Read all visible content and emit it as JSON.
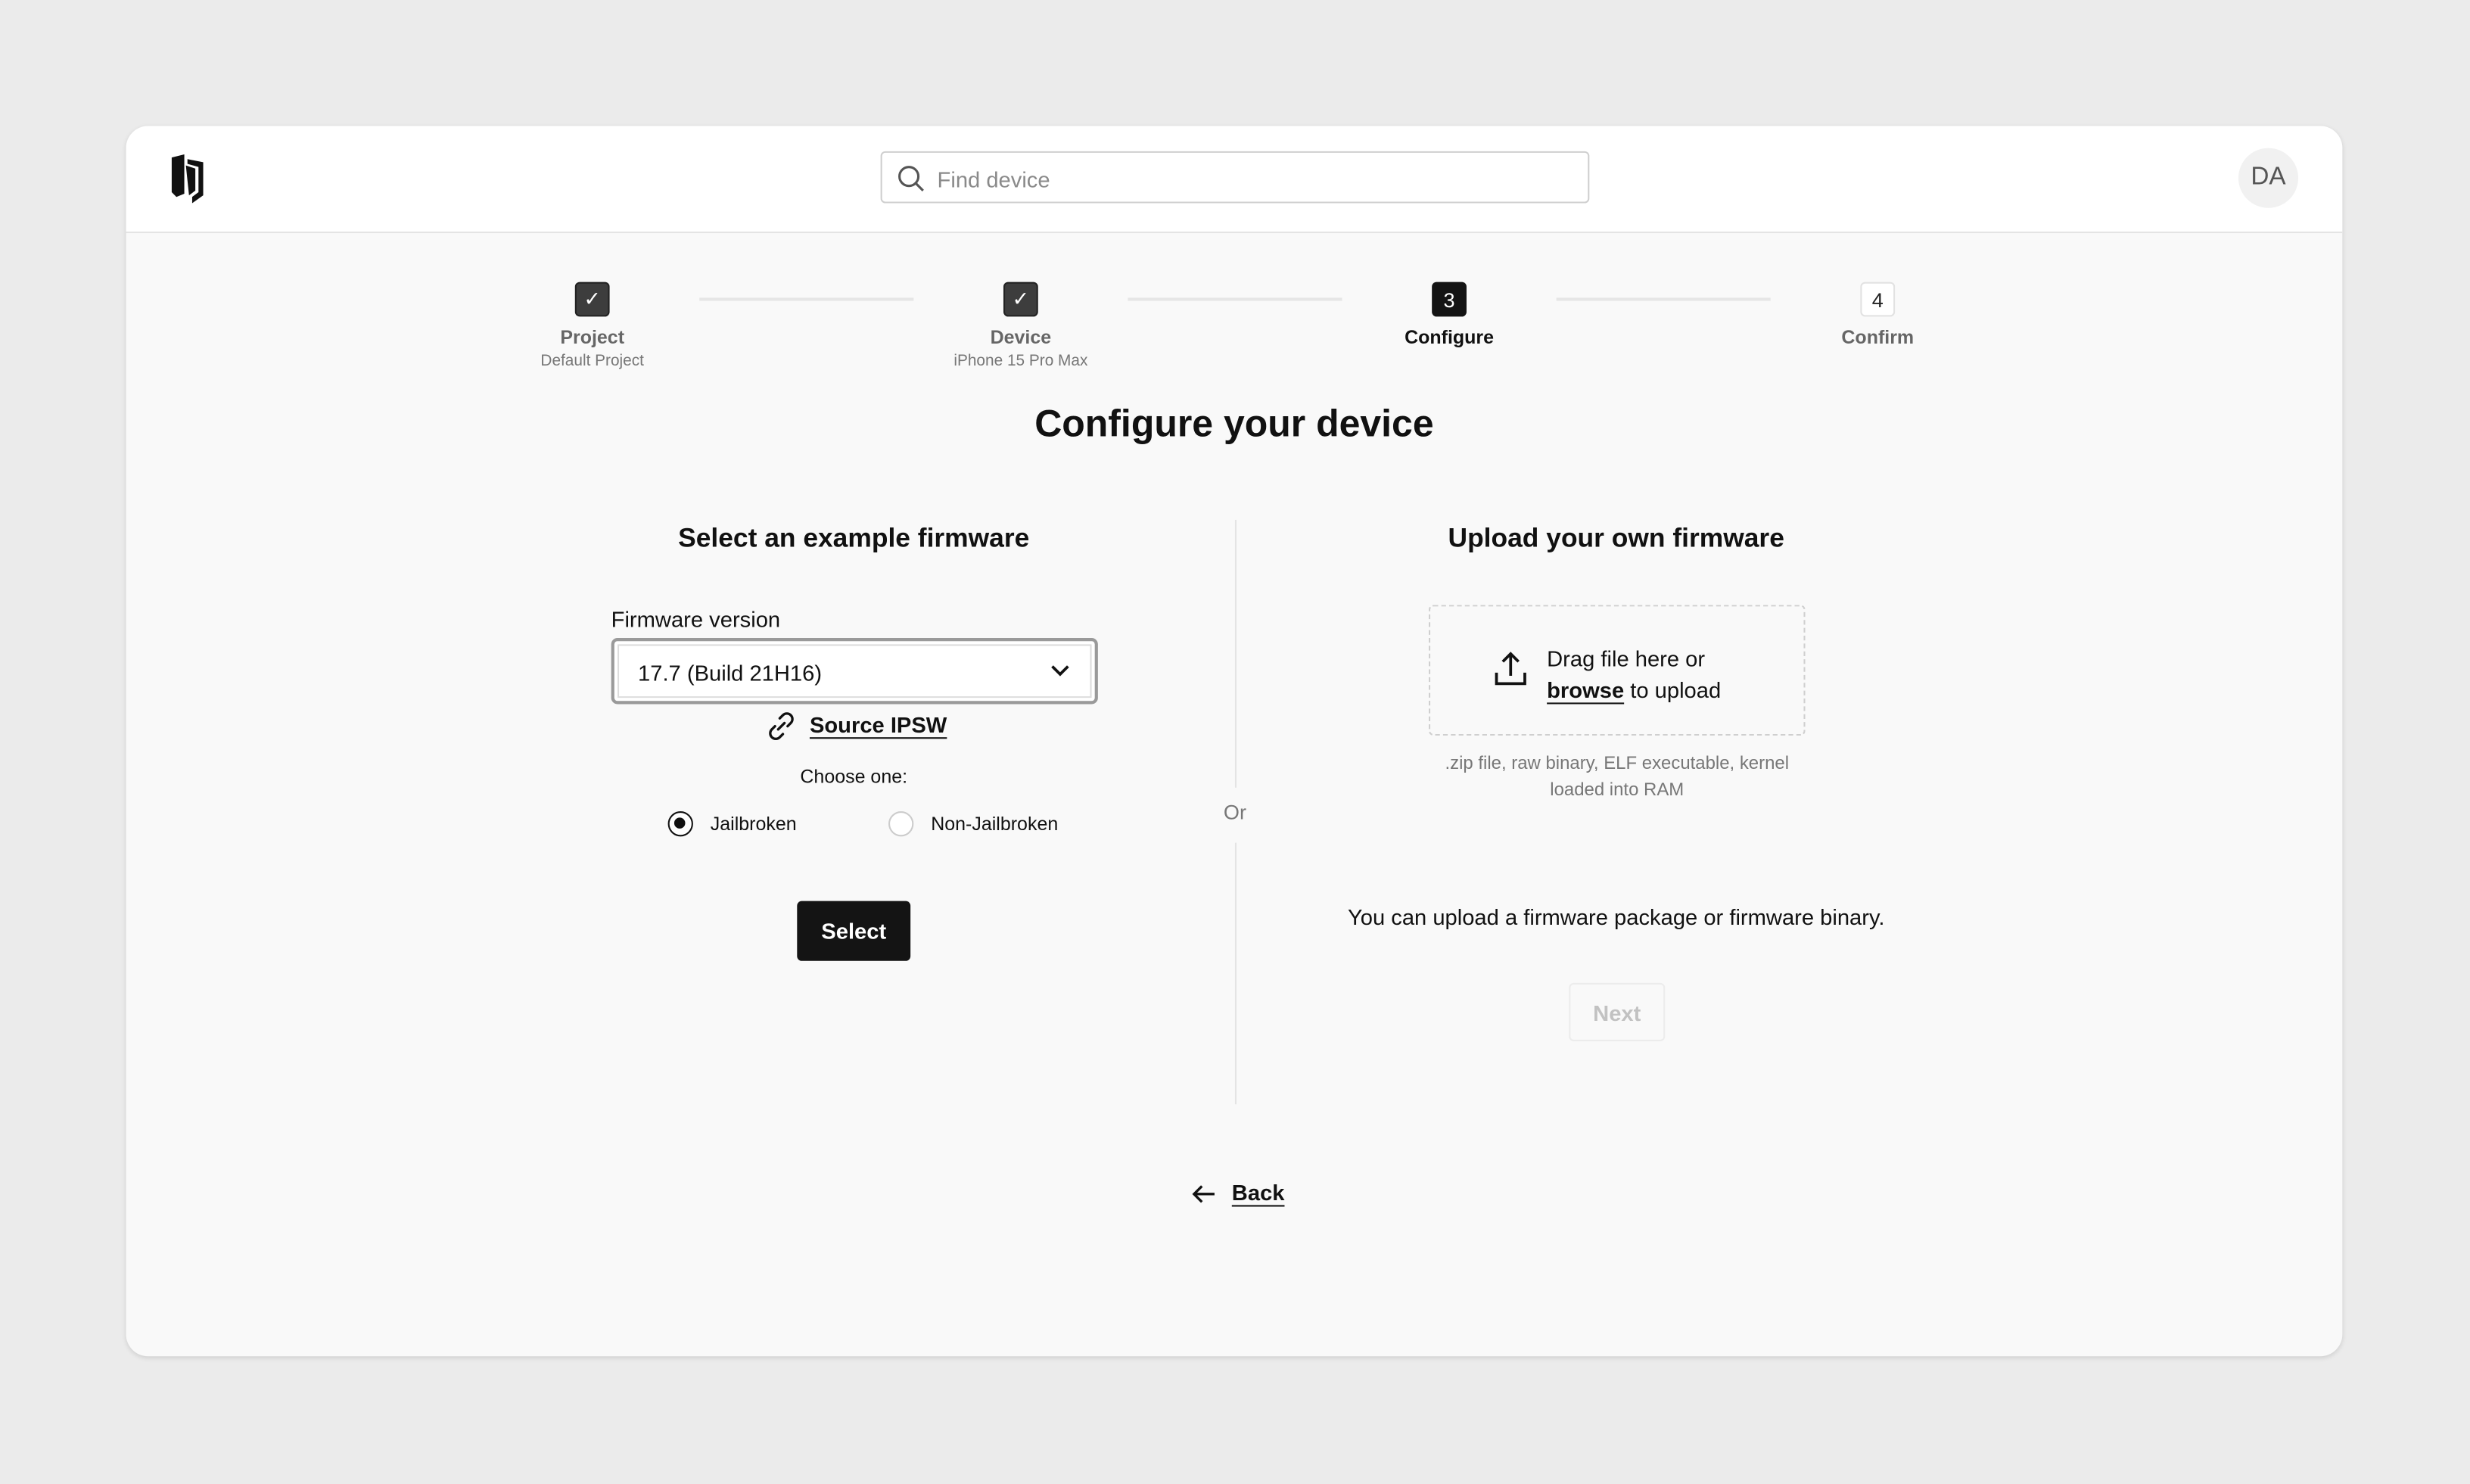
{
  "header": {
    "search_placeholder": "Find device",
    "avatar_initials": "DA"
  },
  "stepper": [
    {
      "label": "Project",
      "sublabel": "Default Project",
      "state": "done"
    },
    {
      "label": "Device",
      "sublabel": "iPhone 15 Pro Max",
      "state": "done"
    },
    {
      "label": "Configure",
      "number": "3",
      "state": "current"
    },
    {
      "label": "Confirm",
      "number": "4",
      "state": "todo"
    }
  ],
  "page_title": "Configure your device",
  "left": {
    "heading": "Select an example firmware",
    "firmware_label": "Firmware version",
    "firmware_value": "17.7 (Build 21H16)",
    "source_link": "Source IPSW",
    "choose_label": "Choose one:",
    "options": [
      {
        "label": "Jailbroken",
        "selected": true
      },
      {
        "label": "Non-Jailbroken",
        "selected": false
      }
    ],
    "select_button": "Select"
  },
  "divider_label": "Or",
  "right": {
    "heading": "Upload your own firmware",
    "drop_line1": "Drag file here or",
    "browse": "browse",
    "drop_line2_rest": " to upload",
    "hint": ".zip file, raw binary, ELF executable, kernel loaded into RAM",
    "info": "You can upload a firmware package or firmware binary.",
    "next_button": "Next"
  },
  "back_label": "Back"
}
